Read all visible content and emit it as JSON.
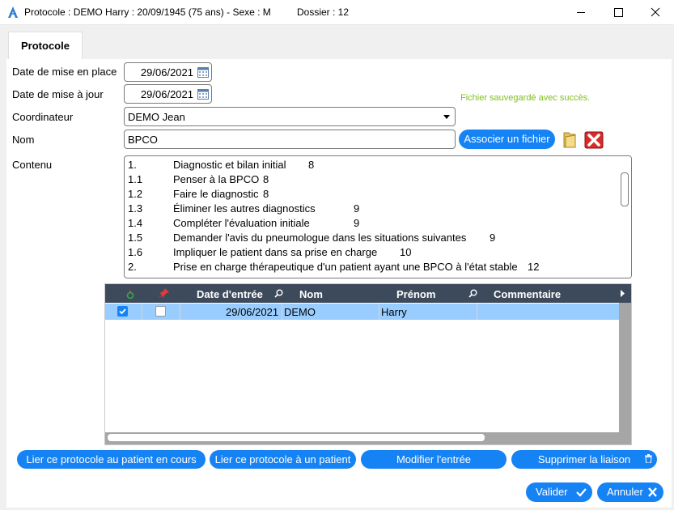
{
  "window": {
    "title": "Protocole : DEMO Harry : 20/09/1945 (75 ans) - Sexe : M",
    "dossier": "Dossier : 12"
  },
  "tab": {
    "label": "Protocole"
  },
  "form": {
    "date_mise_en_place_label": "Date de mise en place",
    "date_mise_en_place": "29/06/2021",
    "date_mise_a_jour_label": "Date de mise à jour",
    "date_mise_a_jour": "29/06/2021",
    "coordinateur_label": "Coordinateur",
    "coordinateur": "DEMO Jean",
    "nom_label": "Nom",
    "nom": "BPCO",
    "contenu_label": "Contenu",
    "success_message": "Fichier sauvegardé avec succès.",
    "associer_label": "Associer un fichier"
  },
  "contenu": [
    {
      "num": "1.",
      "text": "Diagnostic et bilan initial",
      "page": "8"
    },
    {
      "num": "1.1",
      "text": "Penser à la BPCO",
      "page": "8"
    },
    {
      "num": "1.2",
      "text": "Faire le diagnostic",
      "page": "8"
    },
    {
      "num": "1.3",
      "text": "Éliminer les autres diagnostics",
      "page": "9"
    },
    {
      "num": "1.4",
      "text": "Compléter l'évaluation initiale",
      "page": "9"
    },
    {
      "num": "1.5",
      "text": "Demander l'avis du pneumologue dans les situations suivantes",
      "page": "9"
    },
    {
      "num": "1.6",
      "text": "Impliquer le patient dans sa prise en charge",
      "page": "10"
    },
    {
      "num": "2.",
      "text": "Prise en charge thérapeutique d'un patient ayant une BPCO à l'état stable",
      "page": "12"
    }
  ],
  "grid": {
    "columns": [
      "Date d'entrée",
      "Nom",
      "Prénom",
      "Commentaire"
    ],
    "rows": [
      {
        "checked_a": true,
        "checked_b": false,
        "date": "29/06/2021",
        "nom": "DEMO",
        "prenom": "Harry",
        "commentaire": ""
      }
    ]
  },
  "actions": {
    "lier_en_cours": "Lier ce protocole au patient en cours",
    "lier_patient": "Lier ce protocole à un patient",
    "modifier": "Modifier l'entrée",
    "supprimer": "Supprimer la liaison",
    "valider": "Valider",
    "annuler": "Annuler"
  },
  "colors": {
    "accent": "#1683f5",
    "grid_header": "#3d4a5c",
    "row_selected": "#99ccff",
    "success": "#7fbf1f"
  }
}
